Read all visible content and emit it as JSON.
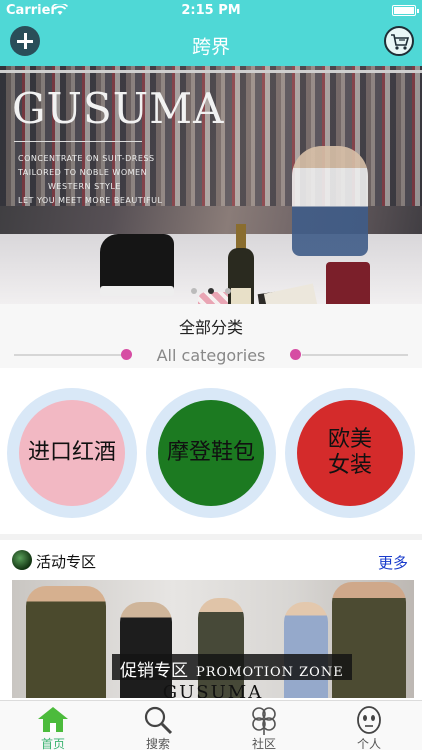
{
  "status_bar": {
    "carrier": "Carrier",
    "time": "2:15 PM"
  },
  "nav": {
    "title": "跨界",
    "left_icon": "plus-icon",
    "right_icon": "cart-icon",
    "accent_color": "#4fd8d6"
  },
  "banner": {
    "brand": "GUSUMA",
    "taglines": [
      "CONCENTRATE ON SUIT-DRESS",
      "TAILORED TO NOBLE WOMEN",
      "WESTERN STYLE",
      "LET YOU MEET MORE BEAUTIFUL"
    ],
    "page_count": 3,
    "active_page": 2
  },
  "categories": {
    "title": "全部分类",
    "subtitle": "All categories",
    "items": [
      {
        "label": "进口红酒",
        "color": "#f2b8c3"
      },
      {
        "label": "摩登鞋包",
        "color": "#1c7a21"
      },
      {
        "label": "欧美\n女装",
        "color": "#d42b2b"
      }
    ]
  },
  "promo": {
    "title": "活动专区",
    "more": "更多",
    "banner_label": "促销专区",
    "banner_label_en": "PROMOTION ZONE",
    "banner_brand": "GUSUMA"
  },
  "tabs": [
    {
      "label": "首页",
      "icon": "home-icon",
      "active": true
    },
    {
      "label": "搜索",
      "icon": "search-icon",
      "active": false
    },
    {
      "label": "社区",
      "icon": "clover-icon",
      "active": false
    },
    {
      "label": "个人",
      "icon": "face-icon",
      "active": false
    }
  ]
}
